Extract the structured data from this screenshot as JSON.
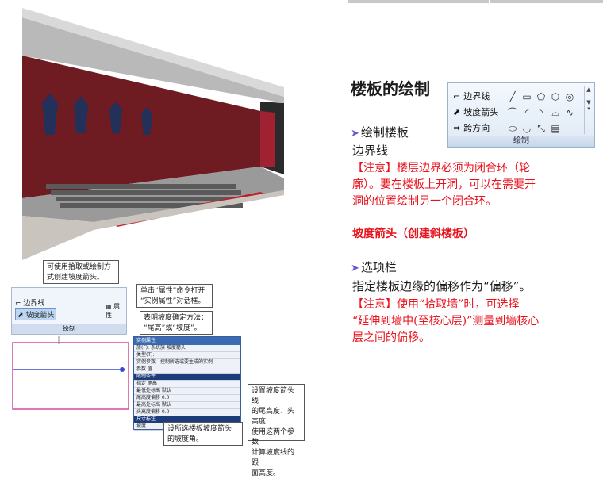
{
  "slide": {
    "title": "楼板的绘制",
    "sketch_bullet": "绘制楼板",
    "boundary_line": "边界线",
    "note1_lines": [
      "【注意】楼层边界必须为闭合环（轮",
      "廓）。要在楼板上开洞，可以在需要开",
      "洞的位置绘制另一个闭合环。"
    ],
    "slope_arrow_title": "坡度箭头（创建斜楼板）",
    "options_bullet": "选项栏",
    "offset_desc": "指定楼板边缘的偏移作为“偏移”。",
    "note2_lines": [
      "【注意】使用“拾取墙”时，可选择",
      "“延伸到墙中(至核心层)”测量到墙核心",
      "层之间的偏移。"
    ]
  },
  "ribbon": {
    "items": [
      "边界线",
      "坡度箭头",
      "跨方向"
    ],
    "caption": "绘制",
    "tool_icons": [
      "line-icon",
      "rectangle-icon",
      "polygon-icon",
      "polygon-outline-icon",
      "circle-icon",
      "arc-start-end-icon",
      "arc-center-icon",
      "arc-tangent-icon",
      "fillet-arc-icon",
      "spline-icon",
      "ellipse-icon",
      "partial-ellipse-icon",
      "pick-lines-icon",
      "pick-walls-icon"
    ]
  },
  "diagram": {
    "ribbon_items": [
      "边界线",
      "坡度箭头"
    ],
    "ribbon_caption": "绘制",
    "properties_label": "属性",
    "callout_pick": [
      "可使用拾取或绘制方",
      "式创建坡度箭头。"
    ],
    "callout_properties": [
      "单击“属性”命令打开",
      "“实例属性”对话框。"
    ],
    "callout_method": [
      "表明坡度确定方法：",
      "“尾高”或“坡度”。"
    ],
    "callout_heights": [
      "设置坡度箭头线",
      "的尾高度、头高度",
      "使用这两个参数",
      "计算坡度线的跟",
      "面高度。"
    ],
    "callout_angle": [
      "设所选楼板坡度箭头",
      "的坡度角。"
    ],
    "dialog": {
      "title": "实例属性",
      "rows": [
        "族(F): 系统族  坡度箭头",
        "类型(T):",
        "实例参数 - 控制所选或要生成的实例",
        "参数                值",
        "限制条件",
        "指定          尾高",
        "最低处标高     默认",
        "尾高度偏移     0.0",
        "最高处标高     默认",
        "头高度偏移     0.0",
        "尺寸标注",
        "坡度"
      ]
    }
  },
  "colors": {
    "note_red": "#e8121c",
    "bullet": "#6a5acd",
    "ribbon_border": "#9bb3cf"
  }
}
